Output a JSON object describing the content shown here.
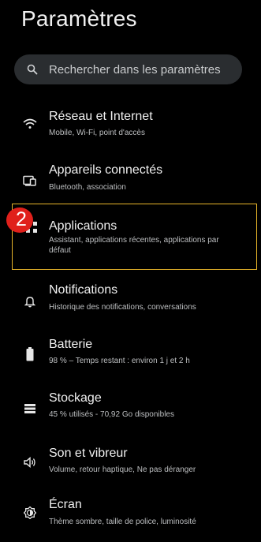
{
  "header": {
    "title": "Paramètres"
  },
  "search": {
    "placeholder": "Rechercher dans les paramètres",
    "icon": "search-icon"
  },
  "settings": {
    "items": [
      {
        "id": "network",
        "icon": "wifi-icon",
        "title": "Réseau et Internet",
        "subtitle": "Mobile, Wi-Fi, point d'accès"
      },
      {
        "id": "connected-devices",
        "icon": "connected-devices-icon",
        "title": "Appareils connectés",
        "subtitle": "Bluetooth, association"
      },
      {
        "id": "apps",
        "icon": "apps-icon",
        "title": "Applications",
        "subtitle": "Assistant, applications récentes, applications par défaut"
      },
      {
        "id": "notifications",
        "icon": "bell-icon",
        "title": "Notifications",
        "subtitle": "Historique des notifications, conversations"
      },
      {
        "id": "battery",
        "icon": "battery-icon",
        "title": "Batterie",
        "subtitle": "98 % – Temps restant : environ 1 j et 2 h"
      },
      {
        "id": "storage",
        "icon": "storage-icon",
        "title": "Stockage",
        "subtitle": "45 % utilisés - 70,92 Go disponibles"
      },
      {
        "id": "sound",
        "icon": "speaker-icon",
        "title": "Son et vibreur",
        "subtitle": "Volume, retour haptique, Ne pas déranger"
      },
      {
        "id": "display",
        "icon": "brightness-icon",
        "title": "Écran",
        "subtitle": "Thème sombre, taille de police, luminosité"
      }
    ]
  },
  "annotation": {
    "step_number": "2",
    "highlight_color": "#e8b52a",
    "badge_color": "#e0201b"
  },
  "colors": {
    "background": "#000000",
    "search_background": "#2a2d30",
    "title_text": "#f0f0f0",
    "subtitle_text": "#bdbfc1"
  }
}
